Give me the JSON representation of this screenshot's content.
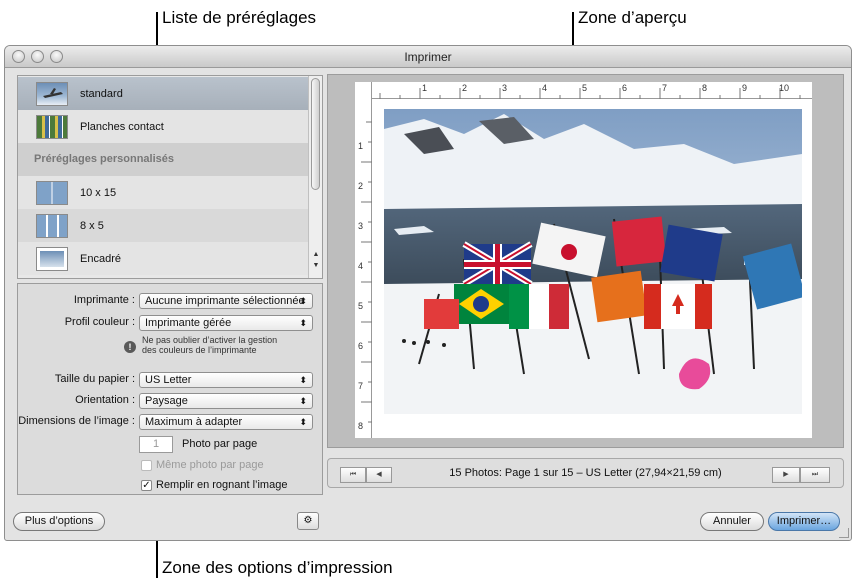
{
  "callouts": {
    "presets": "Liste de préréglages",
    "preview": "Zone d’aperçu",
    "options": "Zone des options d’impression"
  },
  "window": {
    "title": "Imprimer"
  },
  "presets": {
    "items": [
      {
        "label": "standard",
        "selected": true
      },
      {
        "label": "Planches contact"
      }
    ],
    "custom_header": "Préréglages personnalisés",
    "custom_items": [
      {
        "label": "10 x 15"
      },
      {
        "label": "8 x 5"
      },
      {
        "label": "Encadré"
      }
    ]
  },
  "options": {
    "printer": {
      "label": "Imprimante :",
      "value": "Aucune imprimante sélectionnée"
    },
    "color_profile": {
      "label": "Profil couleur :",
      "value": "Imprimante gérée"
    },
    "warning": "Ne pas oublier d’activer la gestion des couleurs de l’imprimante",
    "paper_size": {
      "label": "Taille du papier :",
      "value": "US Letter"
    },
    "orientation": {
      "label": "Orientation :",
      "value": "Paysage"
    },
    "image_size": {
      "label": "Dimensions de l’image :",
      "value": "Maximum à adapter"
    },
    "photos_per_page": {
      "value": "1",
      "label": "Photo par page"
    },
    "same_photo": {
      "label": "Même photo par page",
      "checked": false
    },
    "crop_fill": {
      "label": "Remplir en rognant l’image",
      "checked": true
    }
  },
  "preview": {
    "ruler_h": [
      "1",
      "2",
      "3",
      "4",
      "5",
      "6",
      "7",
      "8",
      "9",
      "10"
    ],
    "ruler_v": [
      "1",
      "2",
      "3",
      "4",
      "5",
      "6",
      "7",
      "8"
    ],
    "nav_info": "15 Photos: Page 1 sur 15 – US Letter (27,94×21,59 cm)"
  },
  "buttons": {
    "more_options": "Plus d’options",
    "cancel": "Annuler",
    "print": "Imprimer…"
  },
  "icons": {
    "first": "⏮",
    "prev": "◀",
    "next": "▶",
    "last": "⏭",
    "check": "✓",
    "gear": "⚙"
  }
}
